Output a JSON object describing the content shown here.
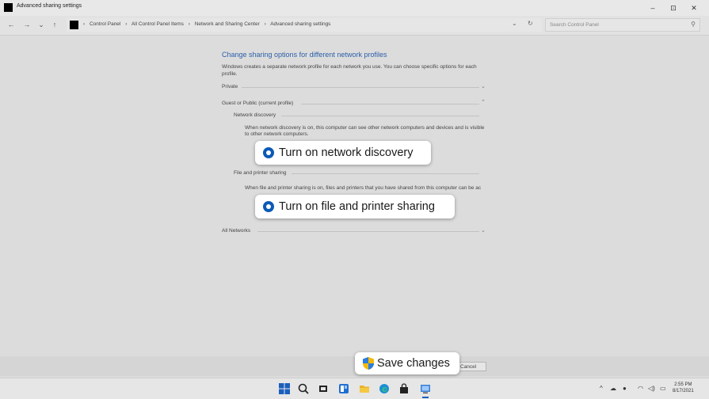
{
  "window": {
    "title": "Advanced sharing settings",
    "minimize": "–",
    "restore": "⊡",
    "close": "✕"
  },
  "nav": {
    "back": "←",
    "forward": "→",
    "recent": "⌄",
    "up": "↑",
    "breadcrumbs": [
      "›",
      "Control Panel",
      "›",
      "All Control Panel Items",
      "›",
      "Network and Sharing Center",
      "›",
      "Advanced sharing settings"
    ],
    "dropdown": "⌄",
    "refresh": "↻",
    "search_placeholder": "Search Control Panel",
    "search_icon": "⚲"
  },
  "main": {
    "heading": "Change sharing options for different network profiles",
    "description": "Windows creates a separate network profile for each network you use. You can choose specific options for each profile.",
    "profiles": {
      "private": "Private",
      "guest_public": "Guest or Public (current profile)",
      "all_networks": "All Networks"
    },
    "network_discovery": {
      "title": "Network discovery",
      "description": "When network discovery is on, this computer can see other network computers and devices and is visible to other network computers.",
      "callout": "Turn on network discovery"
    },
    "file_sharing": {
      "title": "File and printer sharing",
      "description": "When file and printer sharing is on, files and printers that you have shared from this computer can be ac",
      "callout": "Turn on file and printer sharing"
    }
  },
  "footer": {
    "save": "Save changes",
    "cancel": "Cancel"
  },
  "taskbar": {
    "time": "2:55 PM",
    "date": "8/17/2021"
  },
  "colors": {
    "accent": "#0a5ab5",
    "heading": "#2a5fa8"
  }
}
